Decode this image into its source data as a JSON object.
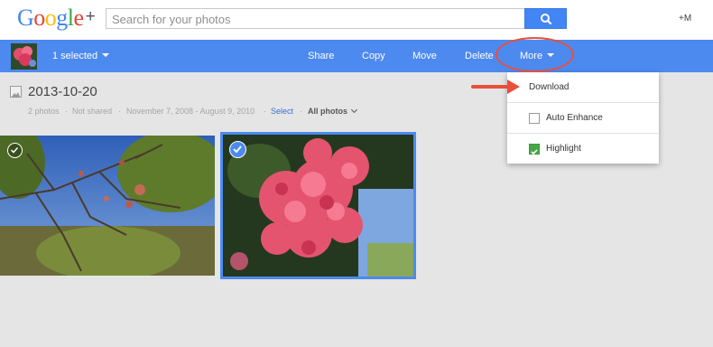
{
  "header": {
    "logo_text": "Google",
    "logo_plus": "+",
    "search_placeholder": "Search for your photos",
    "profile_label": "+M"
  },
  "actionbar": {
    "selected_label": "1 selected",
    "actions": [
      "Share",
      "Copy",
      "Move",
      "Delete",
      "More"
    ]
  },
  "album": {
    "title": "2013-10-20",
    "photo_count": "2 photos",
    "sharing": "Not shared",
    "date_range": "November 7, 2008 - August 9, 2010",
    "select_link": "Select",
    "filter": "All photos"
  },
  "menu": {
    "items": [
      {
        "label": "Download"
      },
      {
        "label": "Auto Enhance",
        "checked": false
      },
      {
        "label": "Highlight",
        "checked": true
      }
    ]
  },
  "colors": {
    "brand_blue": "#4d8af0",
    "annotation_red": "#e8503a",
    "check_green": "#45a847"
  },
  "icons": [
    "search-icon",
    "album-icon",
    "checkmark-icon",
    "caret-down-icon",
    "chevron-down-icon",
    "arrow-right-icon"
  ]
}
